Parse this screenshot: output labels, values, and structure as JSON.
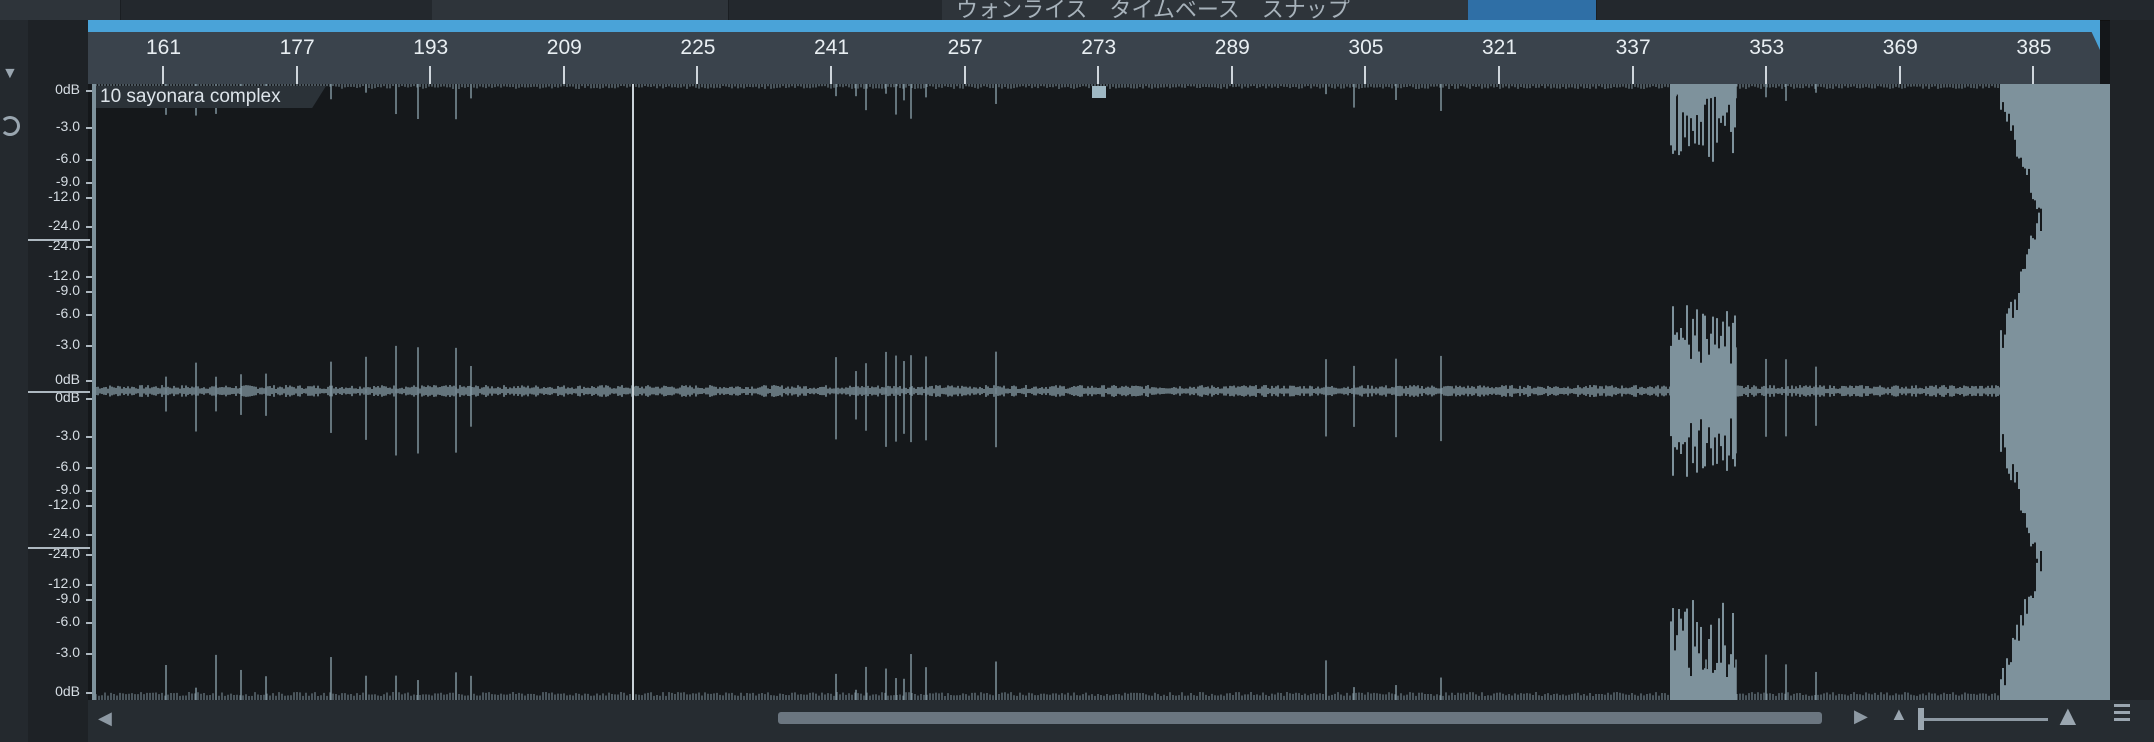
{
  "top_tabs": [
    {
      "label": ""
    },
    {
      "label": ""
    },
    {
      "label": "ウォンライス　タイムベース　スナップ"
    },
    {
      "label": ""
    }
  ],
  "ruler": {
    "ticks": [
      "161",
      "177",
      "193",
      "209",
      "225",
      "241",
      "257",
      "273",
      "289",
      "305",
      "321",
      "337",
      "353",
      "369",
      "385"
    ]
  },
  "clip": {
    "name": "10 sayonara complex"
  },
  "db_scale": {
    "channel1": [
      "0dB",
      "-3.0",
      "-6.0",
      "-9.0",
      "-12.0",
      "-24.0",
      "-24.0",
      "-12.0",
      "-9.0",
      "-6.0",
      "-3.0",
      "0dB"
    ],
    "channel2": [
      "0dB",
      "-3.0",
      "-6.0",
      "-9.0",
      "-12.0",
      "-24.0",
      "-24.0",
      "-12.0",
      "-9.0",
      "-6.0",
      "-3.0",
      "0dB"
    ]
  },
  "colors": {
    "loop_bar": "#4aa3d8",
    "waveform": "#7e929c",
    "background": "#15181b"
  },
  "icons": {
    "track_menu": "triangle-down-icon",
    "loop": "loop-icon",
    "scroll_left": "arrow-left-icon",
    "scroll_right": "arrow-right-icon",
    "zoom_out": "mountain-small-icon",
    "zoom_in": "mountain-large-icon",
    "options": "lines-icon"
  }
}
